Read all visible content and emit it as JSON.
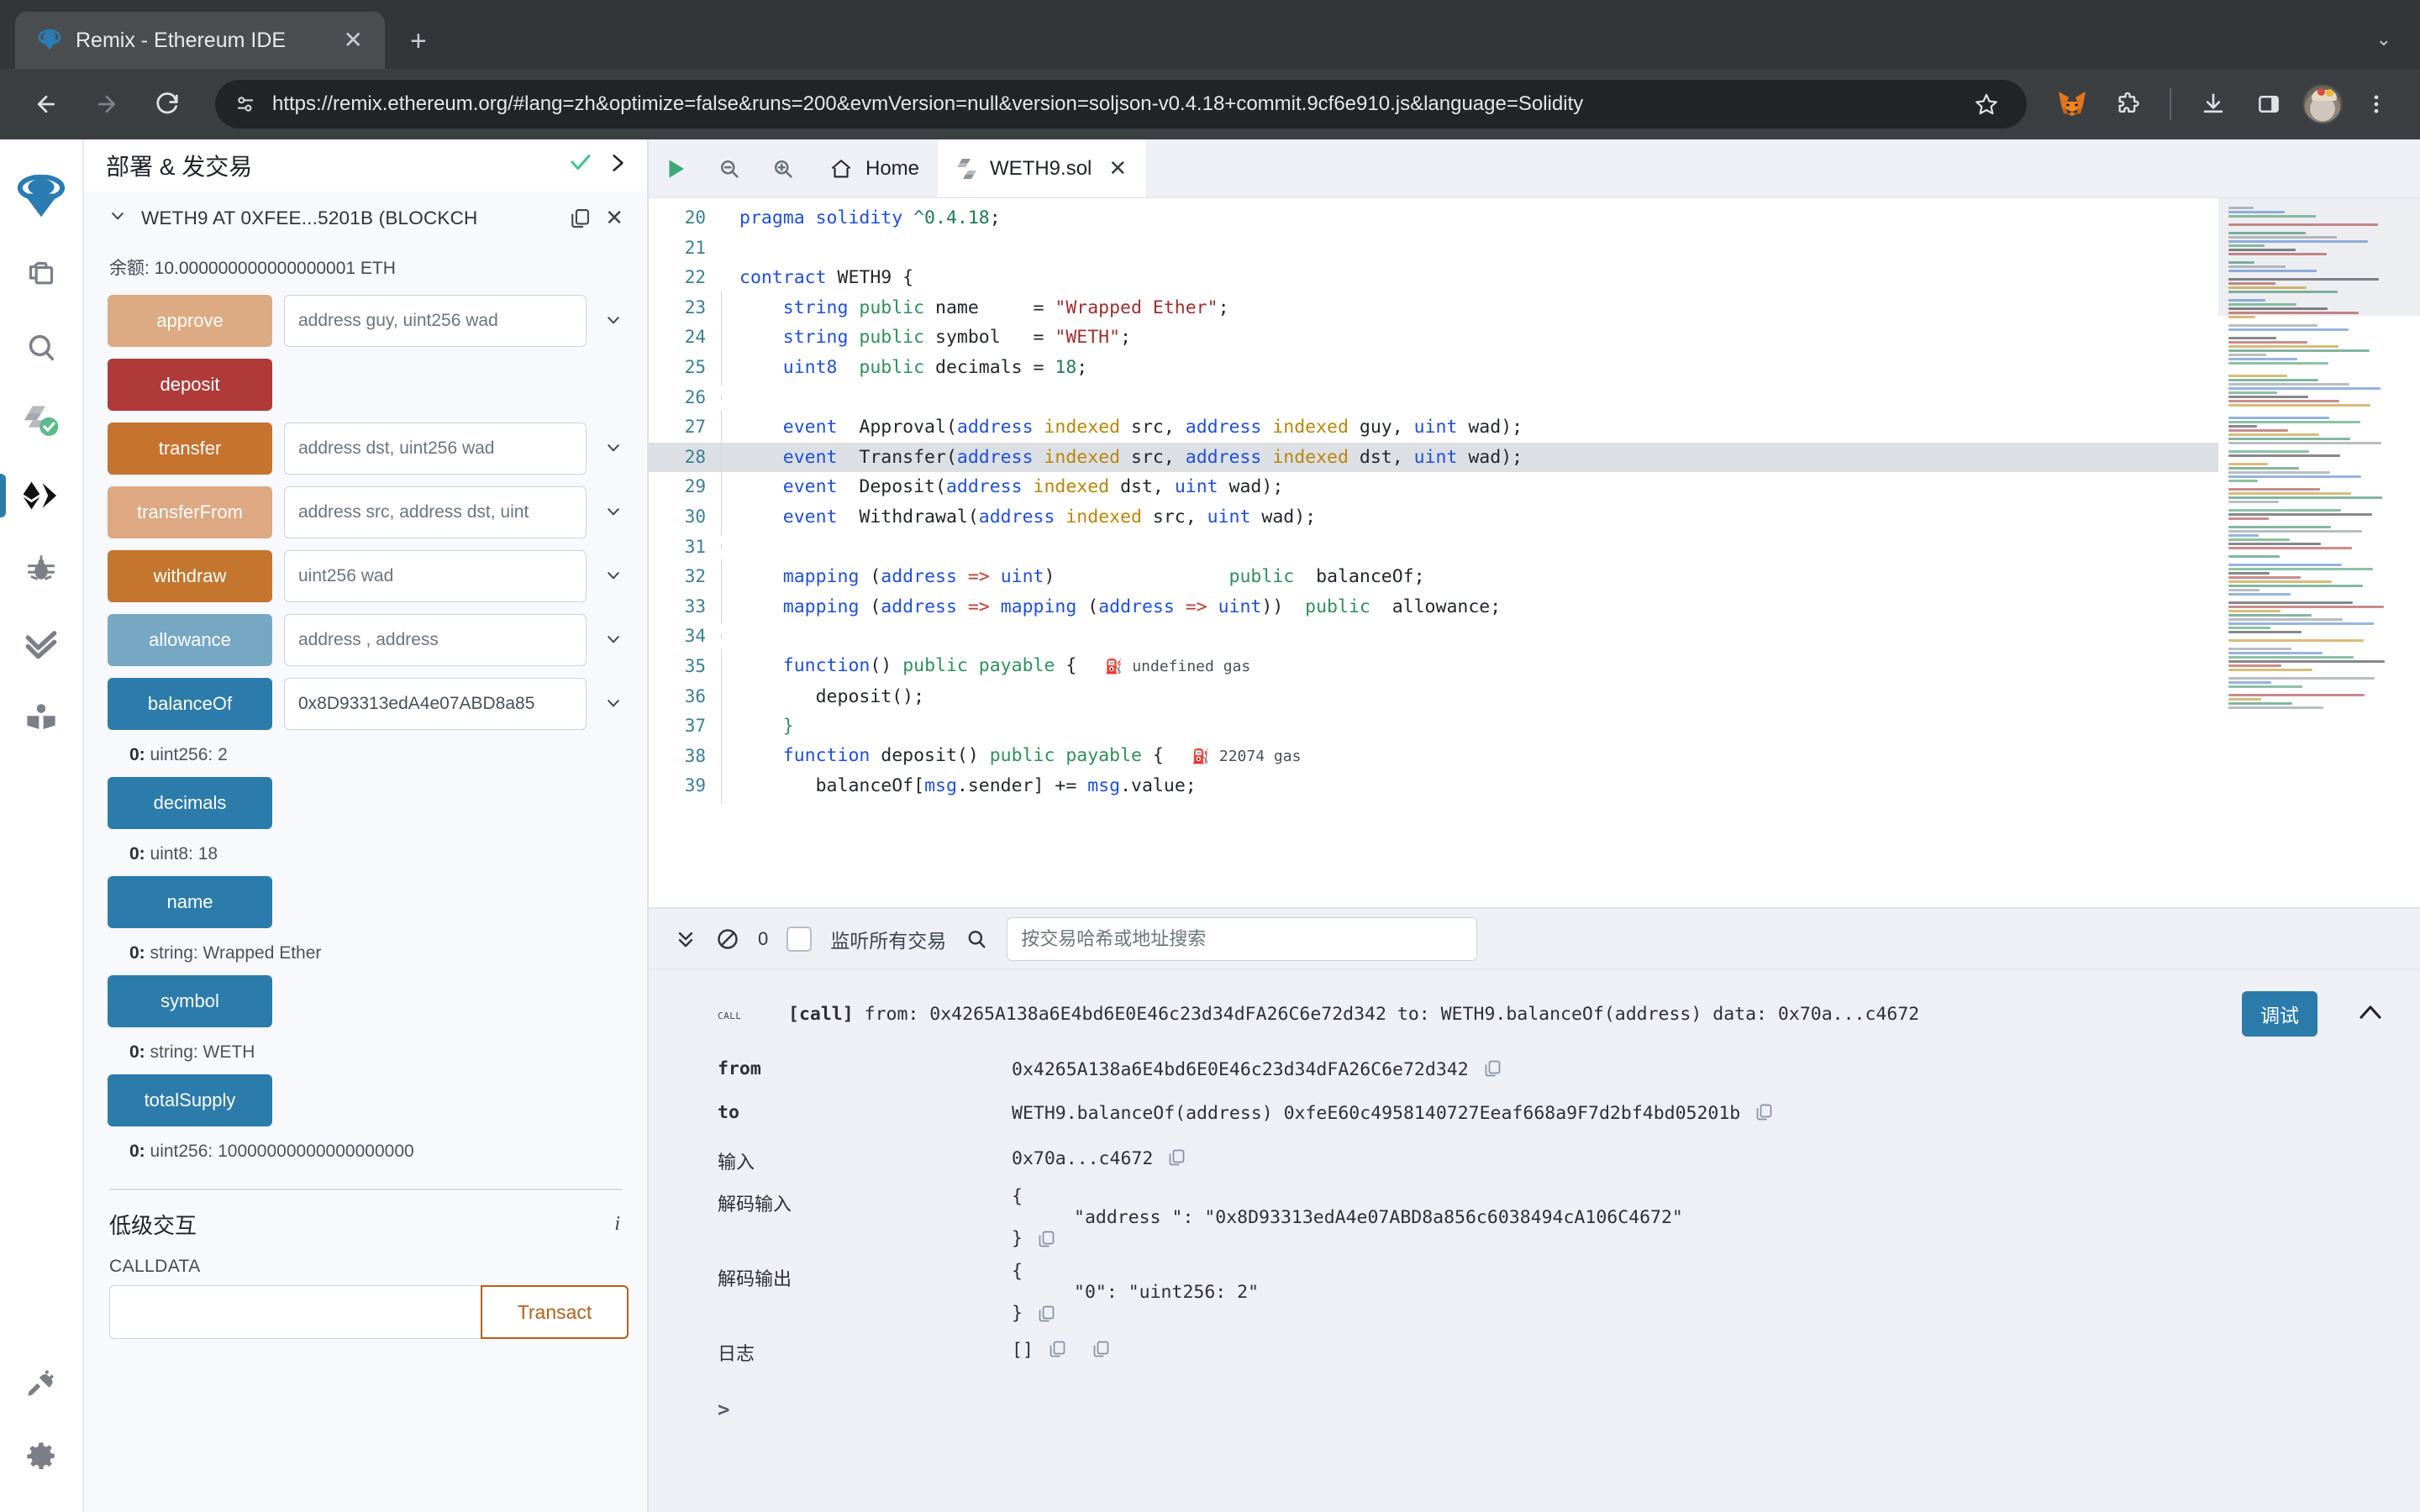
{
  "browser": {
    "tab_title": "Remix - Ethereum IDE",
    "tab_close": "✕",
    "new_tab": "+",
    "window_chevron": "⌄",
    "url": "https://remix.ethereum.org/#lang=zh&optimize=false&runs=200&evmVersion=null&version=soljson-v0.4.18+commit.9cf6e910.js&language=Solidity",
    "icons": {
      "back": "back-arrow-icon",
      "forward": "forward-arrow-icon",
      "reload": "reload-icon",
      "site_info": "site-settings-icon",
      "bookmark": "star-icon",
      "metamask": "metamask-fox-icon",
      "extensions": "puzzle-piece-icon",
      "downloads": "download-icon",
      "sidepanel": "side-panel-icon",
      "profile": "avatar-icon",
      "menu": "three-dot-menu-icon"
    }
  },
  "rail": {
    "items": [
      {
        "name": "remix-logo",
        "label": "Remix"
      },
      {
        "name": "file-explorer-icon",
        "label": "文件浏览器"
      },
      {
        "name": "search-icon",
        "label": "搜索"
      },
      {
        "name": "solidity-compiler-icon",
        "label": "Solidity 编译器"
      },
      {
        "name": "deploy-run-icon",
        "label": "部署 & 发交易"
      },
      {
        "name": "debugger-icon",
        "label": "调试器"
      },
      {
        "name": "analysis-icon",
        "label": "静态分析"
      },
      {
        "name": "docs-icon",
        "label": "文档"
      }
    ],
    "bottom": [
      {
        "name": "plugin-manager-icon",
        "label": "插件管理"
      },
      {
        "name": "settings-gear-icon",
        "label": "设置"
      }
    ]
  },
  "sidebar": {
    "title": "部署 & 发交易",
    "instance": {
      "name": "WETH9 AT 0XFEE...5201B (BLOCKCH",
      "caret": "⌄",
      "copy": "copy-icon",
      "close": "✕"
    },
    "balance": "余额: 10.000000000000000001 ETH",
    "functions": [
      {
        "label": "approve",
        "color": "#ddab83",
        "placeholder": "address guy, uint256 wad",
        "value": "",
        "caret": true,
        "result": null
      },
      {
        "label": "deposit",
        "color": "#b03a3a",
        "placeholder": null,
        "value": null,
        "caret": false,
        "result": null
      },
      {
        "label": "transfer",
        "color": "#c6732f",
        "placeholder": "address dst, uint256 wad",
        "value": "",
        "caret": true,
        "result": null
      },
      {
        "label": "transferFrom",
        "color": "#dda882",
        "placeholder": "address src, address dst, uint",
        "value": "",
        "caret": true,
        "result": null
      },
      {
        "label": "withdraw",
        "color": "#c4762f",
        "placeholder": "uint256 wad",
        "value": "",
        "caret": true,
        "result": null
      },
      {
        "label": "allowance",
        "color": "#76a8c4",
        "placeholder": "address , address",
        "value": "",
        "caret": true,
        "result": null
      },
      {
        "label": "balanceOf",
        "color": "#2c7cab",
        "placeholder": "",
        "value": "0x8D93313edA4e07ABD8a85",
        "caret": true,
        "result": {
          "index": "0:",
          "text": " uint256: 2"
        }
      },
      {
        "label": "decimals",
        "color": "#2c7cab",
        "placeholder": null,
        "value": null,
        "caret": false,
        "result": {
          "index": "0:",
          "text": " uint8: 18"
        }
      },
      {
        "label": "name",
        "color": "#2c7cab",
        "placeholder": null,
        "value": null,
        "caret": false,
        "result": {
          "index": "0:",
          "text": " string: Wrapped Ether"
        }
      },
      {
        "label": "symbol",
        "color": "#2c7cab",
        "placeholder": null,
        "value": null,
        "caret": false,
        "result": {
          "index": "0:",
          "text": " string: WETH"
        }
      },
      {
        "label": "totalSupply",
        "color": "#2c7cab",
        "placeholder": null,
        "value": null,
        "caret": false,
        "result": {
          "index": "0:",
          "text": " uint256: 10000000000000000000"
        }
      }
    ],
    "lowlevel": {
      "title": "低级交互",
      "info_icon": "i",
      "calldata_label": "CALLDATA",
      "calldata_value": "",
      "transact_label": "Transact"
    }
  },
  "editor": {
    "toolbar": {
      "run": "run-icon",
      "zoom_out": "zoom-out-icon",
      "zoom_in": "zoom-in-icon"
    },
    "tabs": [
      {
        "label": "Home",
        "icon": "home-icon",
        "active": false,
        "closable": false
      },
      {
        "label": "WETH9.sol",
        "icon": "solidity-file-icon",
        "active": true,
        "closable": true
      }
    ],
    "first_line": 20,
    "highlighted_line": 28,
    "lines": [
      {
        "n": 20,
        "guide": false,
        "tokens": [
          {
            "t": "pragma ",
            "c": "kw"
          },
          {
            "t": "solidity ",
            "c": "kw"
          },
          {
            "t": "^0.4.18",
            "c": "num"
          },
          {
            "t": ";",
            "c": "plain"
          }
        ]
      },
      {
        "n": 21,
        "guide": false,
        "tokens": []
      },
      {
        "n": 22,
        "guide": false,
        "tokens": [
          {
            "t": "contract ",
            "c": "kw"
          },
          {
            "t": "WETH9 {",
            "c": "plain"
          }
        ]
      },
      {
        "n": 23,
        "guide": true,
        "tokens": [
          {
            "t": "    ",
            "c": "plain"
          },
          {
            "t": "string ",
            "c": "kw"
          },
          {
            "t": "public ",
            "c": "kw2"
          },
          {
            "t": "name     = ",
            "c": "plain"
          },
          {
            "t": "\"Wrapped Ether\"",
            "c": "str"
          },
          {
            "t": ";",
            "c": "plain"
          }
        ]
      },
      {
        "n": 24,
        "guide": true,
        "tokens": [
          {
            "t": "    ",
            "c": "plain"
          },
          {
            "t": "string ",
            "c": "kw"
          },
          {
            "t": "public ",
            "c": "kw2"
          },
          {
            "t": "symbol   = ",
            "c": "plain"
          },
          {
            "t": "\"WETH\"",
            "c": "str"
          },
          {
            "t": ";",
            "c": "plain"
          }
        ]
      },
      {
        "n": 25,
        "guide": true,
        "tokens": [
          {
            "t": "    ",
            "c": "plain"
          },
          {
            "t": "uint8  ",
            "c": "kw"
          },
          {
            "t": "public ",
            "c": "kw2"
          },
          {
            "t": "decimals = ",
            "c": "plain"
          },
          {
            "t": "18",
            "c": "num"
          },
          {
            "t": ";",
            "c": "plain"
          }
        ]
      },
      {
        "n": 26,
        "guide": true,
        "tokens": []
      },
      {
        "n": 27,
        "guide": true,
        "tokens": [
          {
            "t": "    ",
            "c": "plain"
          },
          {
            "t": "event ",
            "c": "kw"
          },
          {
            "t": " Approval(",
            "c": "plain"
          },
          {
            "t": "address ",
            "c": "typ"
          },
          {
            "t": "indexed ",
            "c": "idx"
          },
          {
            "t": "src, ",
            "c": "plain"
          },
          {
            "t": "address ",
            "c": "typ"
          },
          {
            "t": "indexed ",
            "c": "idx"
          },
          {
            "t": "guy, ",
            "c": "plain"
          },
          {
            "t": "uint ",
            "c": "typ"
          },
          {
            "t": "wad);",
            "c": "plain"
          }
        ]
      },
      {
        "n": 28,
        "guide": true,
        "tokens": [
          {
            "t": "    ",
            "c": "plain"
          },
          {
            "t": "event ",
            "c": "kw"
          },
          {
            "t": " Transfer(",
            "c": "plain"
          },
          {
            "t": "address ",
            "c": "typ"
          },
          {
            "t": "indexed ",
            "c": "idx"
          },
          {
            "t": "src, ",
            "c": "plain"
          },
          {
            "t": "address ",
            "c": "typ"
          },
          {
            "t": "indexed ",
            "c": "idx"
          },
          {
            "t": "dst, ",
            "c": "plain"
          },
          {
            "t": "uint ",
            "c": "typ"
          },
          {
            "t": "wad);",
            "c": "plain"
          }
        ]
      },
      {
        "n": 29,
        "guide": true,
        "tokens": [
          {
            "t": "    ",
            "c": "plain"
          },
          {
            "t": "event ",
            "c": "kw"
          },
          {
            "t": " Deposit(",
            "c": "plain"
          },
          {
            "t": "address ",
            "c": "typ"
          },
          {
            "t": "indexed ",
            "c": "idx"
          },
          {
            "t": "dst, ",
            "c": "plain"
          },
          {
            "t": "uint ",
            "c": "typ"
          },
          {
            "t": "wad);",
            "c": "plain"
          }
        ]
      },
      {
        "n": 30,
        "guide": true,
        "tokens": [
          {
            "t": "    ",
            "c": "plain"
          },
          {
            "t": "event ",
            "c": "kw"
          },
          {
            "t": " Withdrawal(",
            "c": "plain"
          },
          {
            "t": "address ",
            "c": "typ"
          },
          {
            "t": "indexed ",
            "c": "idx"
          },
          {
            "t": "src, ",
            "c": "plain"
          },
          {
            "t": "uint ",
            "c": "typ"
          },
          {
            "t": "wad);",
            "c": "plain"
          }
        ]
      },
      {
        "n": 31,
        "guide": true,
        "tokens": []
      },
      {
        "n": 32,
        "guide": true,
        "tokens": [
          {
            "t": "    ",
            "c": "plain"
          },
          {
            "t": "mapping ",
            "c": "kw"
          },
          {
            "t": "(",
            "c": "plain"
          },
          {
            "t": "address ",
            "c": "typ"
          },
          {
            "t": "=>",
            "c": "pun"
          },
          {
            "t": " uint",
            "c": "typ"
          },
          {
            "t": ")                ",
            "c": "plain"
          },
          {
            "t": "public ",
            "c": "kw2"
          },
          {
            "t": " balanceOf;",
            "c": "plain"
          }
        ]
      },
      {
        "n": 33,
        "guide": true,
        "tokens": [
          {
            "t": "    ",
            "c": "plain"
          },
          {
            "t": "mapping ",
            "c": "kw"
          },
          {
            "t": "(",
            "c": "plain"
          },
          {
            "t": "address ",
            "c": "typ"
          },
          {
            "t": "=>",
            "c": "pun"
          },
          {
            "t": " mapping ",
            "c": "kw"
          },
          {
            "t": "(",
            "c": "plain"
          },
          {
            "t": "address ",
            "c": "typ"
          },
          {
            "t": "=>",
            "c": "pun"
          },
          {
            "t": " uint",
            "c": "typ"
          },
          {
            "t": "))  ",
            "c": "plain"
          },
          {
            "t": "public ",
            "c": "kw2"
          },
          {
            "t": " allowance;",
            "c": "plain"
          }
        ]
      },
      {
        "n": 34,
        "guide": true,
        "tokens": []
      },
      {
        "n": 35,
        "guide": true,
        "tokens": [
          {
            "t": "    ",
            "c": "plain"
          },
          {
            "t": "function",
            "c": "kw"
          },
          {
            "t": "() ",
            "c": "plain"
          },
          {
            "t": "public payable ",
            "c": "kw2"
          },
          {
            "t": "{",
            "c": "plain"
          }
        ],
        "gas": "undefined gas"
      },
      {
        "n": 36,
        "guide": true,
        "tokens": [
          {
            "t": "       deposit();",
            "c": "plain"
          }
        ]
      },
      {
        "n": 37,
        "guide": true,
        "tokens": [
          {
            "t": "    }",
            "c": "kw2"
          }
        ]
      },
      {
        "n": 38,
        "guide": true,
        "tokens": [
          {
            "t": "    ",
            "c": "plain"
          },
          {
            "t": "function ",
            "c": "kw"
          },
          {
            "t": "deposit() ",
            "c": "plain"
          },
          {
            "t": "public payable ",
            "c": "kw2"
          },
          {
            "t": "{",
            "c": "plain"
          }
        ],
        "gas": "22074 gas"
      },
      {
        "n": 39,
        "guide": true,
        "tokens": [
          {
            "t": "       balanceOf[",
            "c": "plain"
          },
          {
            "t": "msg",
            "c": "typ"
          },
          {
            "t": ".sender] += ",
            "c": "plain"
          },
          {
            "t": "msg",
            "c": "typ"
          },
          {
            "t": ".value;",
            "c": "plain"
          }
        ]
      }
    ]
  },
  "terminal": {
    "toolbar": {
      "collapse_all_icon": "chevrons-down-icon",
      "clear_icon": "no-entry-icon",
      "count": "0",
      "listen_checkbox_checked": false,
      "listen_label": "监听所有交易",
      "search_icon": "search-icon",
      "search_placeholder": "按交易哈希或地址搜索",
      "search_value": ""
    },
    "transaction": {
      "tag": "call",
      "summary_prefix": "[call]",
      "summary": "from: 0x4265A138a6E4bd6E0E46c23d34dFA26C6e72d342 to: WETH9.balanceOf(address) data: 0x70a...c4672",
      "from_label": "from",
      "from_value": "0x4265A138a6E4bd6E0E46c23d34dFA26C6e72d342",
      "to_label": "to",
      "to_value": "WETH9.balanceOf(address) 0xfeE60c4958140727Eeaf668a9F7d2bf4bd05201b",
      "input_label": "输入",
      "input_value": "0x70a...c4672",
      "decoded_input_label": "解码输入",
      "decoded_input_open": "{",
      "decoded_input_body": "\"address \": \"0x8D93313edA4e07ABD8a856c6038494cA106C4672\"",
      "decoded_input_close": "}",
      "decoded_output_label": "解码输出",
      "decoded_output_open": "{",
      "decoded_output_body": "\"0\": \"uint256: 2\"",
      "decoded_output_close": "}",
      "logs_label": "日志",
      "logs_value": "[]",
      "debug_label": "调试",
      "collapse_icon": "chevron-up-icon",
      "copy_icon": "copy-icon"
    },
    "prompt": ">"
  },
  "colors": {
    "accent": "#2c7cab",
    "warn": "#b4601c",
    "danger": "#b03a3a",
    "success": "#3ec487",
    "chrome_bg": "#323639",
    "panel_bg": "#f8f9fc",
    "terminal_bg": "#eef0f5"
  }
}
